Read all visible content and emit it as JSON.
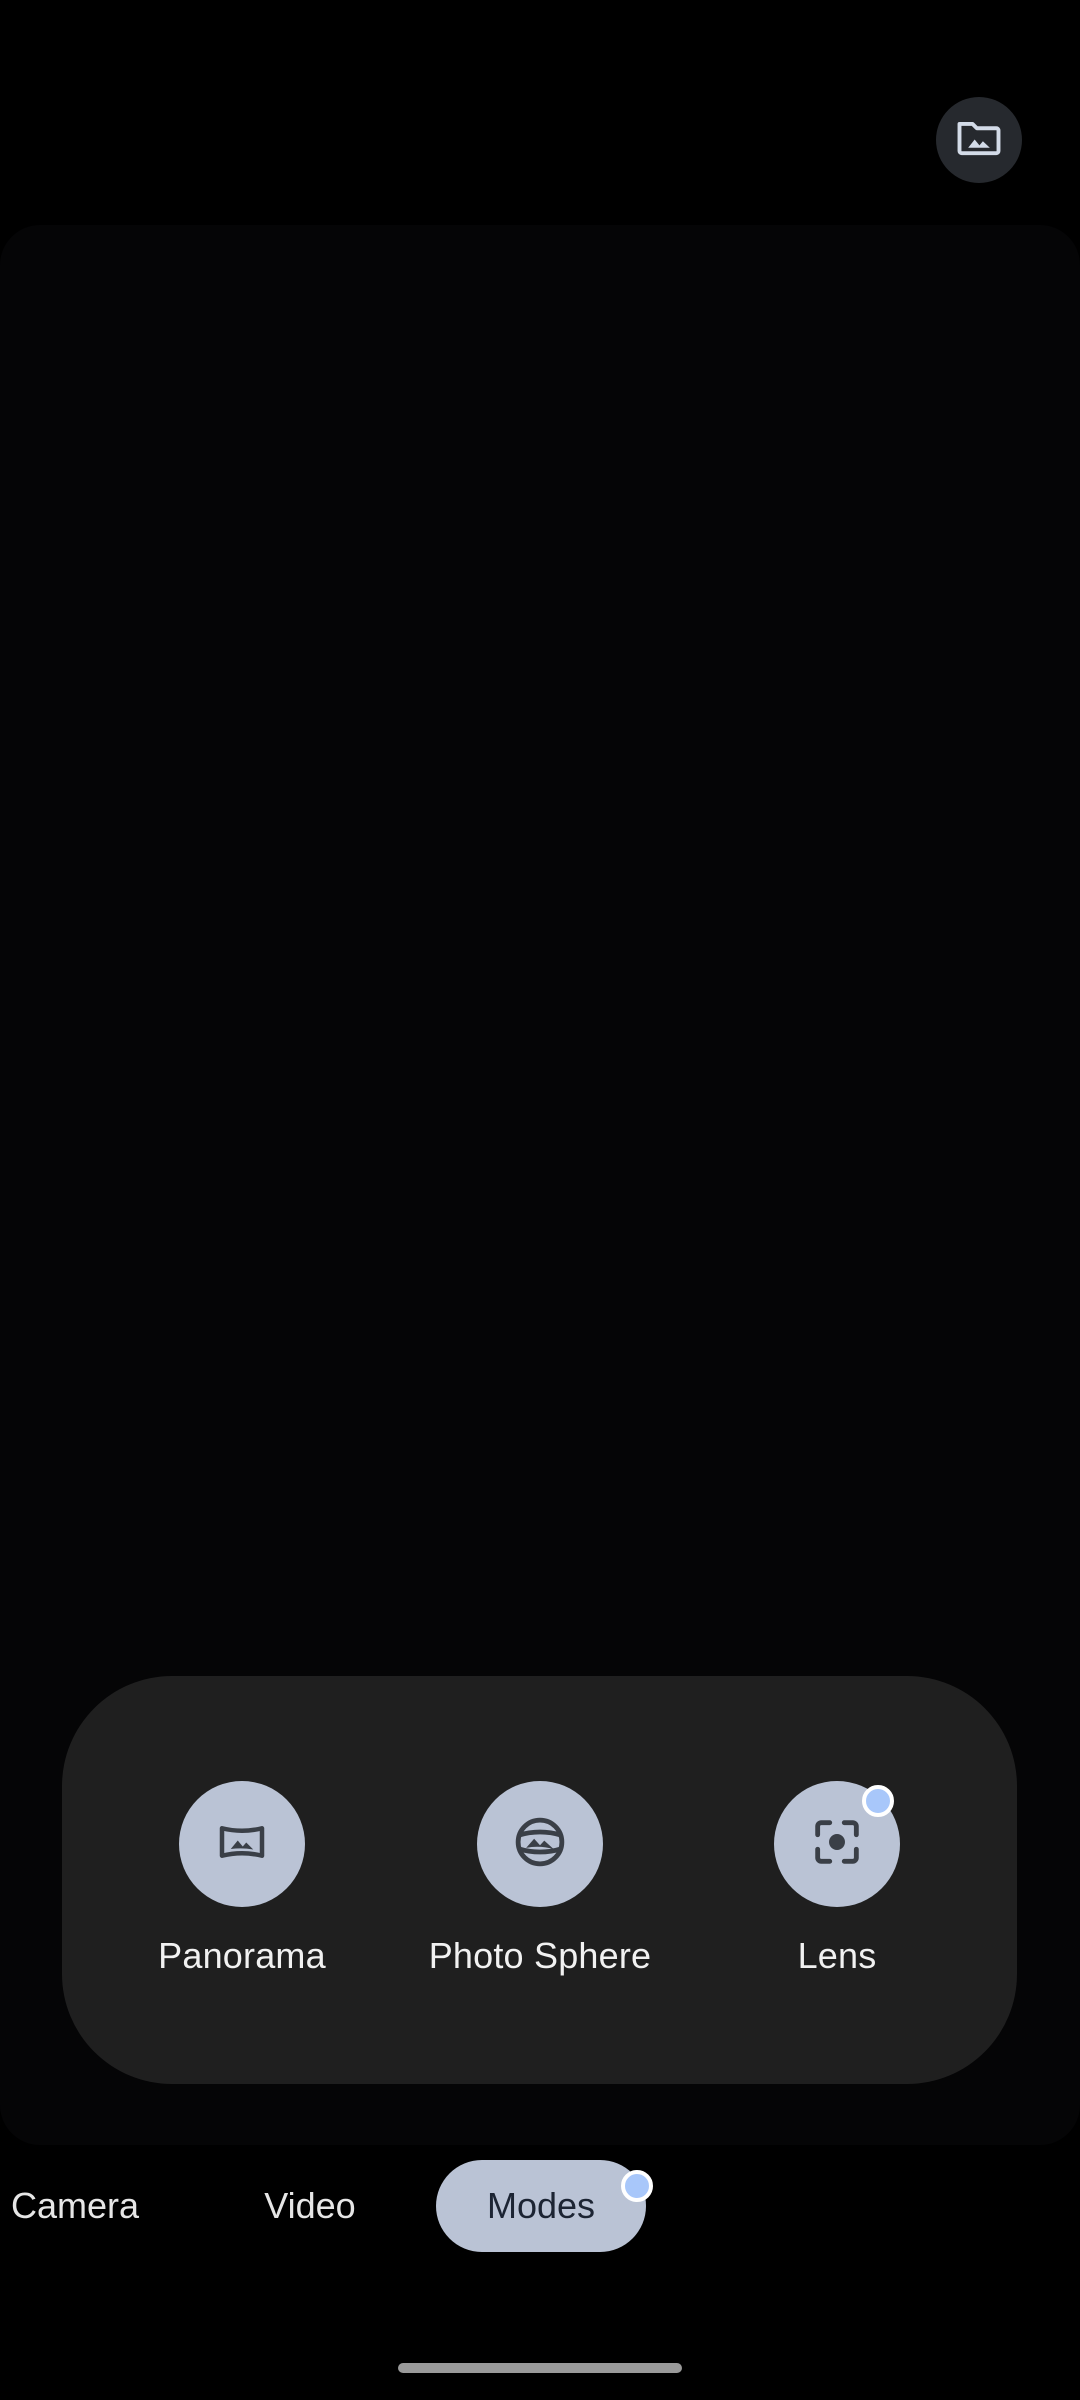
{
  "gallery": {
    "icon": "gallery-folder-icon"
  },
  "modes": {
    "items": [
      {
        "label": "Panorama",
        "icon": "panorama-icon",
        "new": false
      },
      {
        "label": "Photo Sphere",
        "icon": "photo-sphere-icon",
        "new": false
      },
      {
        "label": "Lens",
        "icon": "lens-icon",
        "new": true
      }
    ]
  },
  "tabs": {
    "items": [
      {
        "label": "Camera",
        "active": false
      },
      {
        "label": "Video",
        "active": false
      },
      {
        "label": "Modes",
        "active": true,
        "new": true
      }
    ]
  },
  "colors": {
    "accent": "#bac3d5",
    "panel": "#1f1f1f",
    "new_dot": "#a8c7fa"
  }
}
